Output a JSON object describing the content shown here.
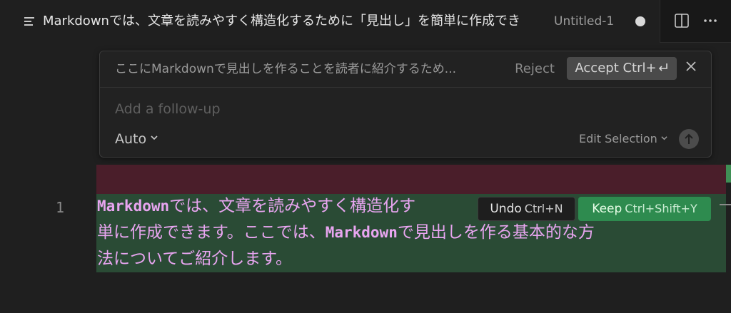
{
  "tab": {
    "icon": "markdown-file-icon",
    "title": "Markdownでは、文章を読みやすく構造化するために「見出し」を簡単に作成でき",
    "description": "Untitled-1",
    "dirty_indicator": "unsaved-dot-icon"
  },
  "toolbar": {
    "split_icon": "split-editor-icon",
    "more_icon": "more-actions-icon"
  },
  "chat": {
    "prompt": "ここにMarkdownで見出しを作ることを読者に紹介するため...",
    "reject_label": "Reject",
    "accept_label": "Accept Ctrl+",
    "accept_key_icon": "enter-key-icon",
    "followup_placeholder": "Add a follow-up",
    "mode_label": "Auto",
    "edit_selection_label": "Edit Selection",
    "send_icon": "arrow-up-icon"
  },
  "editor": {
    "line_number": "1",
    "lines": [
      {
        "kw": "Markdown",
        "text": "では、文章を読みやすく構造化す"
      },
      {
        "pre": "単に作成できます。ここでは、",
        "kw": "Markdown",
        "text": "で見出しを作る基本的な方"
      },
      {
        "text": "法についてご紹介します。"
      }
    ]
  },
  "diff_actions": {
    "undo_label": "Undo",
    "undo_shortcut": "Ctrl+N",
    "keep_label": "Keep",
    "keep_shortcut": "Ctrl+Shift+Y"
  },
  "colors": {
    "added": "#2a4b35",
    "removed": "#4a1e2a",
    "keep": "#2e8b4f",
    "text_magenta": "#e8a5f0"
  }
}
